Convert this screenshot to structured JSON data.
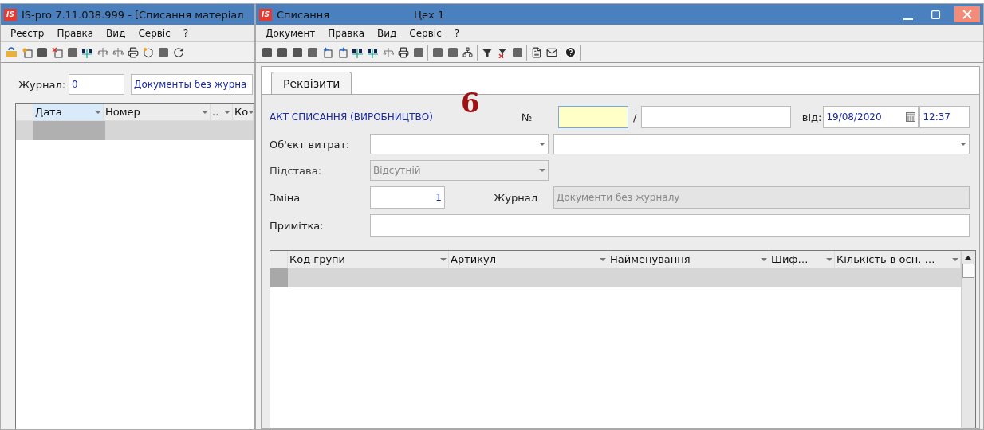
{
  "back_window": {
    "logo": "IS",
    "title": "IS-pro 7.11.038.999 - [Списання матеріал",
    "menu": [
      "Реєстр",
      "Правка",
      "Вид",
      "Сервіс",
      "?"
    ],
    "journal": {
      "label": "Журнал:",
      "value": "0",
      "name": "Документы без журна"
    },
    "table": {
      "columns": [
        {
          "label": "Дата",
          "selected": true
        },
        {
          "label": "Номер",
          "selected": false
        },
        {
          "label": "..",
          "selected": false
        },
        {
          "label": "Ко",
          "selected": false
        }
      ]
    }
  },
  "window": {
    "logo": "IS",
    "title": "Списання",
    "subtitle": "Цех 1",
    "menu": [
      "Документ",
      "Правка",
      "Вид",
      "Сервіс",
      "?"
    ],
    "tabs": [
      {
        "label": "Реквізити",
        "selected": true
      }
    ],
    "annotation": "6",
    "form": {
      "doc_type": "АКТ СПИСАННЯ (ВИРОБНИЦТВО)",
      "number_label": "№",
      "separator": "/",
      "date_label": "від:",
      "date": "19/08/2020",
      "time": "12:37",
      "cost_object_label": "Об'єкт витрат:",
      "basis_label": "Підстава:",
      "basis_value": "Відсутній",
      "shift_label": "Зміна",
      "shift_value": "1",
      "journal_label": "Журнал",
      "journal_value": "Документи без журналу",
      "note_label": "Примітка:"
    },
    "table": {
      "columns": [
        "Код групи",
        "Артикул",
        "Найменування",
        "Шиф…",
        "Кількість в осн. …"
      ]
    }
  }
}
